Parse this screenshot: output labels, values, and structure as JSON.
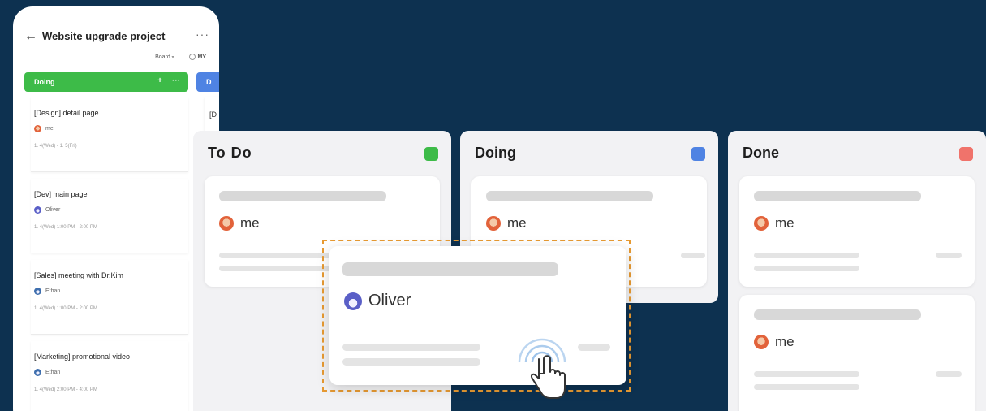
{
  "phone": {
    "title": "Website upgrade project",
    "view_select": "Board",
    "my_label": "MY",
    "column": {
      "label": "Doing",
      "add": "+",
      "more": "···"
    },
    "next_column_label": "D",
    "next_column_card_label": "[D",
    "back": "←",
    "more": "···",
    "tasks": [
      {
        "title": "[Design] detail page",
        "assignee": "me",
        "avatar": "me",
        "date": "1. 4(Wed) - 1. 5(Fri)"
      },
      {
        "title": "[Dev] main page",
        "assignee": "Oliver",
        "avatar": "oliver",
        "date": "1. 4(Wed) 1:00 PM - 2:00 PM"
      },
      {
        "title": "[Sales] meeting with Dr.Kim",
        "assignee": "Ethan",
        "avatar": "ethan",
        "date": "1. 4(Wed) 1:00 PM - 2:00 PM"
      },
      {
        "title": "[Marketing] promotional video",
        "assignee": "Ethan",
        "avatar": "ethan",
        "date": "1. 4(Wed) 2:00 PM - 4:00 PM"
      }
    ]
  },
  "board": {
    "columns": [
      {
        "id": "todo",
        "title": "To Do",
        "color": "#3dbb48",
        "cards": [
          {
            "assignee": "me"
          }
        ]
      },
      {
        "id": "doing",
        "title": "Doing",
        "color": "#4f83e3",
        "cards": [
          {
            "assignee": "me"
          }
        ]
      },
      {
        "id": "done",
        "title": "Done",
        "color": "#f0736b",
        "cards": [
          {
            "assignee": "me"
          },
          {
            "assignee": "me"
          }
        ]
      }
    ],
    "dragging_card": {
      "assignee": "Oliver"
    }
  },
  "colors": {
    "background": "#0d3150",
    "drag_outline": "#e79a32",
    "cursor_ripple": "#9ec3ea"
  }
}
